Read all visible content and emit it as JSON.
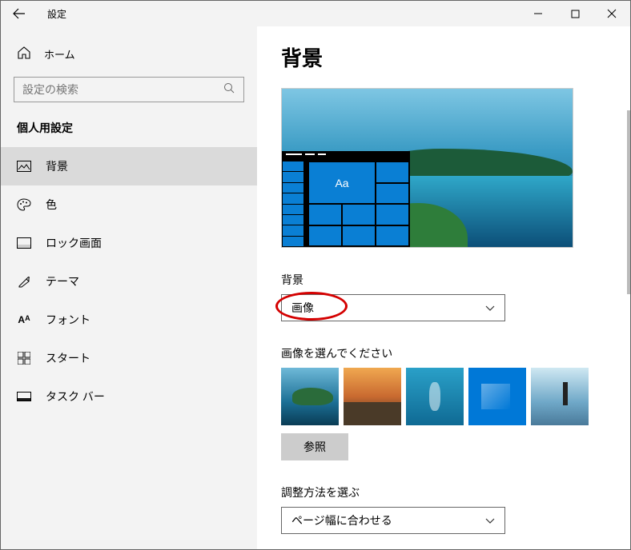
{
  "window": {
    "title": "設定"
  },
  "sidebar": {
    "home": "ホーム",
    "searchPlaceholder": "設定の検索",
    "section": "個人用設定",
    "items": [
      {
        "label": "背景"
      },
      {
        "label": "色"
      },
      {
        "label": "ロック画面"
      },
      {
        "label": "テーマ"
      },
      {
        "label": "フォント"
      },
      {
        "label": "スタート"
      },
      {
        "label": "タスク バー"
      }
    ]
  },
  "main": {
    "heading": "背景",
    "previewTile": "Aa",
    "bgLabel": "背景",
    "bgDropdown": "画像",
    "chooseLabel": "画像を選んでください",
    "browse": "参照",
    "fitLabel": "調整方法を選ぶ",
    "fitDropdown": "ページ幅に合わせる"
  }
}
